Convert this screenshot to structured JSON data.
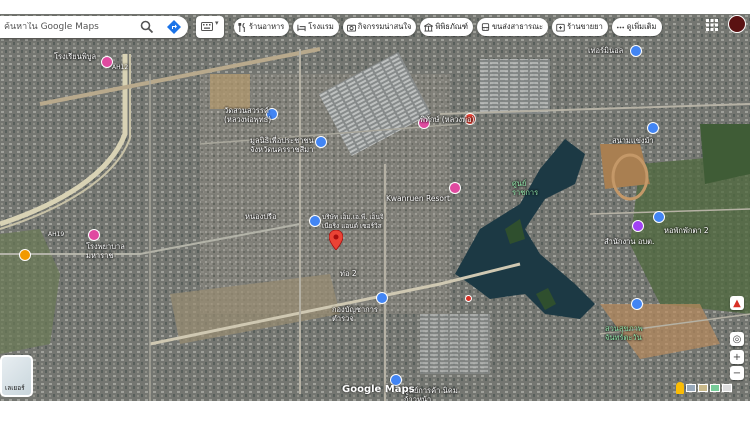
{
  "search": {
    "placeholder": "ค้นหาใน Google Maps"
  },
  "chips": [
    {
      "icon": "fork-knife-icon",
      "label": "ร้านอาหาร"
    },
    {
      "icon": "bed-icon",
      "label": "โรงแรม"
    },
    {
      "icon": "camera-icon",
      "label": "กิจกรรมน่าสนใจ"
    },
    {
      "icon": "museum-icon",
      "label": "พิพิธภัณฑ์"
    },
    {
      "icon": "bus-icon",
      "label": "ขนส่งสาธารณะ"
    },
    {
      "icon": "pharmacy-icon",
      "label": "ร้านขายยา"
    },
    {
      "icon": "more-icon",
      "label": "ดูเพิ่มเติม"
    }
  ],
  "map_labels": [
    "โรงเรียนพิบูล",
    "วัดสวนสวรรค์ (หลวงพ่อพุทธ)",
    "โรงพยาบาลมหาราช",
    "พิทักษ์ (หลวงพ่อ)",
    "มูลนิธิเพื่อประชาชน จังหวัดนครราชสีมา",
    "Kwanruen Resort",
    "บริษัท เอ็ม.เอ.พี. เอ็นจิเนียริ่ง แอนด์ เซอร์วิส",
    "ศูนย์ราชการ",
    "สนามแข่งม้า",
    "หอพักพักตา 2",
    "สำนักงาน อบต.",
    "ท่อ 2",
    "กองบัญชาการ ตำรวจ",
    "ศูนย์การค้า นิคมก้าวหน้า",
    "เทอร์มินอล",
    "AH12",
    "AH19",
    "สวนสุขภาพ จันทร์ตะวัน",
    "หนองปรือ"
  ],
  "layers_label": "เลเยอร์",
  "branding": "Google Maps",
  "zoom": {
    "in": "+",
    "out": "−"
  },
  "colors": {
    "pin": "#ea4335",
    "hotel_pin": "#e04aa0",
    "place_pin": "#4285f4",
    "water": "#1c3944",
    "park": "#2f5b34"
  }
}
